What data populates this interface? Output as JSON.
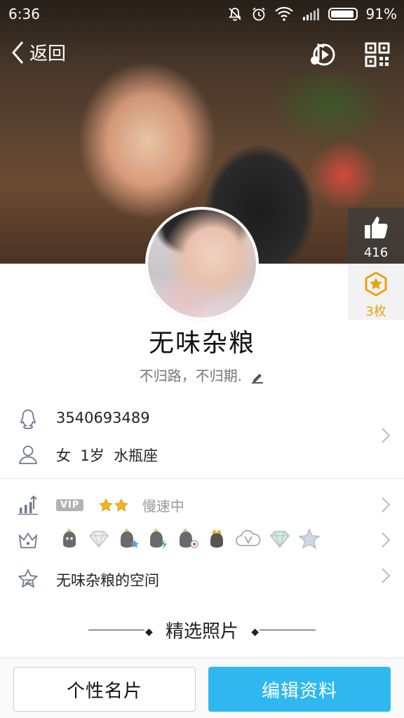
{
  "status_bar": {
    "time": "6:36",
    "battery": "91%"
  },
  "nav": {
    "back_label": "返回"
  },
  "like": {
    "count": "416"
  },
  "badge": {
    "count": "3枚"
  },
  "profile": {
    "name": "无味杂粮",
    "signature": "不归路，不归期."
  },
  "info": {
    "qq_number": "3540693489",
    "gender": "女",
    "age": "1岁",
    "zodiac": "水瓶座"
  },
  "vip": {
    "tag": "VIP",
    "status": "慢速中"
  },
  "space": {
    "label": "无味杂粮的空间"
  },
  "photos": {
    "section_title": "精选照片"
  },
  "buttons": {
    "card": "个性名片",
    "edit": "编辑资料"
  },
  "colors": {
    "accent": "#2fb8f0",
    "badge": "#e8a317"
  }
}
